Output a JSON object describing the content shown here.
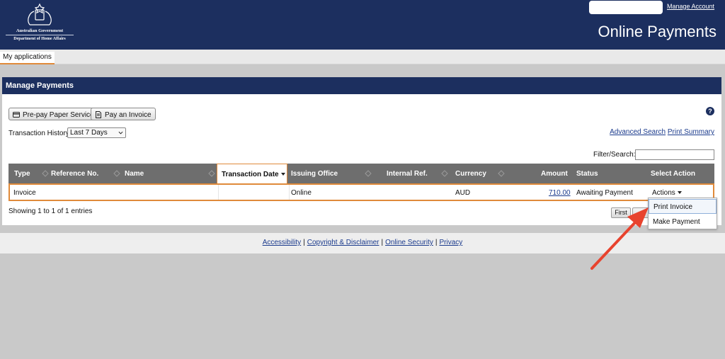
{
  "header": {
    "gov_line": "Australian Government",
    "dept_line": "Department of Home Affairs",
    "manage_account": "Manage Account",
    "title": "Online Payments"
  },
  "tabs": [
    {
      "label": "My applications",
      "active": true
    }
  ],
  "panel": {
    "title": "Manage Payments",
    "buttons": {
      "prepay": "Pre-pay Paper Service",
      "pay_invoice": "Pay an Invoice"
    },
    "history_label": "Transaction History",
    "history_selected": "Last 7 Days",
    "links": {
      "advanced_search": "Advanced Search",
      "print_summary": "Print Summary"
    },
    "filter_label": "Filter/Search:"
  },
  "table": {
    "columns": [
      "Type",
      "Reference No.",
      "Name",
      "Transaction Date",
      "Issuing Office",
      "Internal Ref.",
      "Currency",
      "Amount",
      "Status",
      "Select Action"
    ],
    "rows": [
      {
        "type": "Invoice",
        "reference": "",
        "name": "",
        "transaction_date": "",
        "issuing_office": "Online",
        "internal_ref": "",
        "currency": "AUD",
        "amount": "710.00",
        "status": "Awaiting Payment",
        "action": "Actions"
      }
    ],
    "showing": "Showing 1 to 1 of 1 entries",
    "pager_first": "First"
  },
  "dropdown": {
    "items": [
      "Print Invoice",
      "Make Payment"
    ]
  },
  "footer": {
    "links": [
      "Accessibility",
      "Copyright & Disclaimer",
      "Online Security",
      "Privacy"
    ]
  },
  "colors": {
    "header_bg": "#1c2f5f",
    "accent_orange": "#e08a3a",
    "table_header": "#6e6e6e",
    "link": "#1a3a8c",
    "annotation_arrow": "#e8432e"
  }
}
